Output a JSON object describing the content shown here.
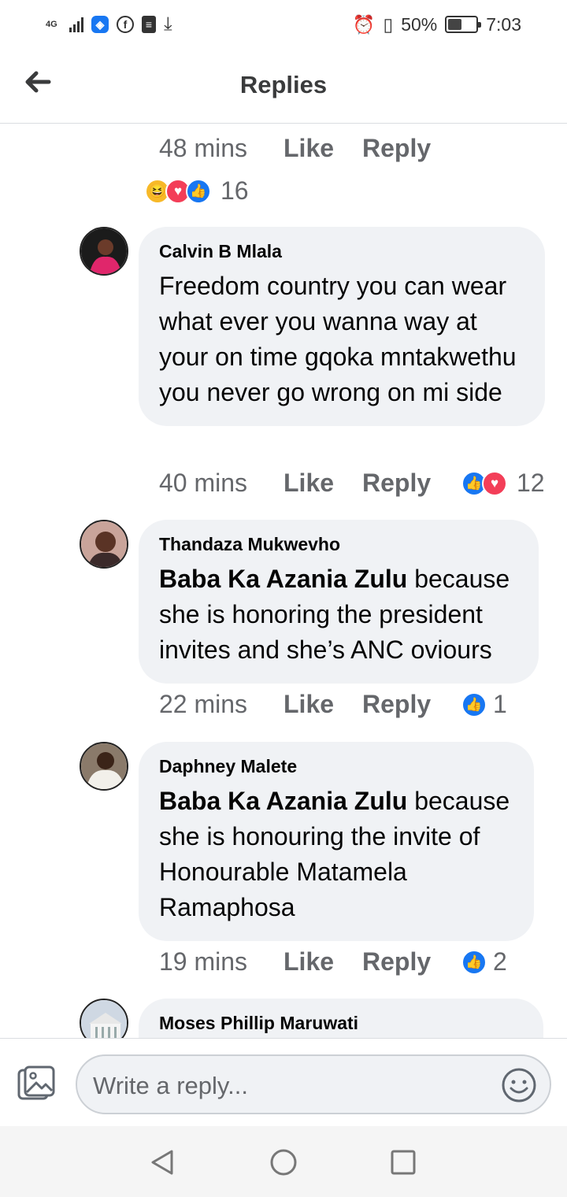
{
  "status_bar": {
    "network": "4G",
    "battery": "50%",
    "battery_level": 0.5,
    "time": "7:03"
  },
  "header": {
    "title": "Replies"
  },
  "top_comment_meta": {
    "time": "48 mins",
    "like": "Like",
    "reply": "Reply",
    "reactions": [
      "haha",
      "love",
      "like"
    ],
    "reaction_count": "16"
  },
  "replies": [
    {
      "author": "Calvin B Mlala",
      "mention": "",
      "text": "Freedom country you can wear what ever you wanna way at your on time gqoka mntakwethu you never go wrong on mi side",
      "time": "40 mins",
      "like": "Like",
      "reply": "Reply",
      "reactions": [
        "like",
        "love"
      ],
      "reaction_count": "12"
    },
    {
      "author": "Thandaza Mukwevho",
      "mention": "Baba Ka Azania Zulu",
      "text": " because she is honoring the president invites and she’s ANC oviours",
      "time": "22 mins",
      "like": "Like",
      "reply": "Reply",
      "reactions": [
        "like"
      ],
      "reaction_count": "1"
    },
    {
      "author": "Daphney Malete",
      "mention": "Baba Ka Azania Zulu",
      "text": " because she is honouring the invite of Honourable Matamela Ramaphosa",
      "time": "19 mins",
      "like": "Like",
      "reply": "Reply",
      "reactions": [
        "like"
      ],
      "reaction_count": "2"
    },
    {
      "author": "Moses Phillip Maruwati",
      "mention": "",
      "text": ""
    }
  ],
  "composer": {
    "placeholder": "Write a reply..."
  },
  "icons": {
    "back": "arrow-left-icon",
    "photo": "photo-icon",
    "emoji": "smiley-icon",
    "nav_back": "triangle-back-icon",
    "nav_home": "circle-home-icon",
    "nav_recents": "square-recents-icon"
  },
  "colors": {
    "accent": "#1877f2",
    "love": "#f33e58",
    "haha": "#f7b928",
    "bubble": "#f0f2f5",
    "muted_text": "#65676b"
  }
}
